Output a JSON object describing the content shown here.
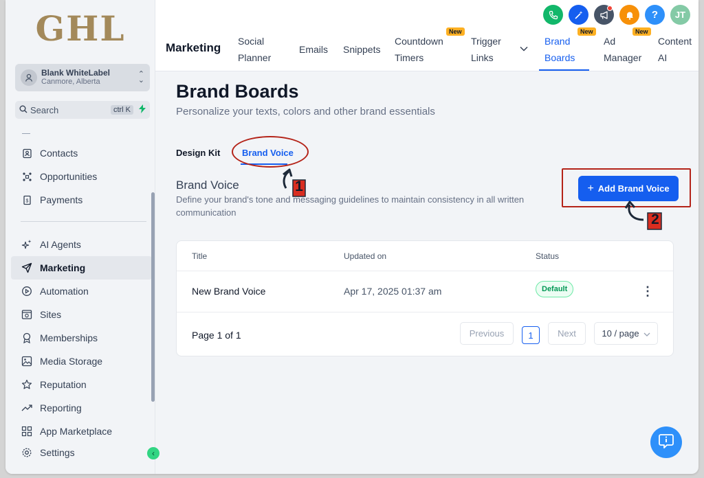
{
  "brand": {
    "logo_text": "GHL"
  },
  "account": {
    "name": "Blank WhiteLabel",
    "location": "Canmore, Alberta"
  },
  "search": {
    "label": "Search",
    "shortcut": "ctrl K"
  },
  "sidebar": {
    "items_top": [
      {
        "label": "Contacts",
        "icon": "contacts-icon"
      },
      {
        "label": "Opportunities",
        "icon": "opportunities-icon"
      },
      {
        "label": "Payments",
        "icon": "payments-icon"
      }
    ],
    "items_bottom": [
      {
        "label": "AI Agents",
        "icon": "sparkle-icon"
      },
      {
        "label": "Marketing",
        "icon": "send-icon",
        "active": true
      },
      {
        "label": "Automation",
        "icon": "automation-icon"
      },
      {
        "label": "Sites",
        "icon": "sites-icon"
      },
      {
        "label": "Memberships",
        "icon": "award-icon"
      },
      {
        "label": "Media Storage",
        "icon": "image-icon"
      },
      {
        "label": "Reputation",
        "icon": "star-icon"
      },
      {
        "label": "Reporting",
        "icon": "trend-icon"
      },
      {
        "label": "App Marketplace",
        "icon": "grid-icon"
      },
      {
        "label": "Settings",
        "icon": "gear-icon"
      }
    ]
  },
  "header": {
    "section": "Marketing",
    "tabs": [
      {
        "line1": "Social",
        "line2": "Planner"
      },
      {
        "line1": "Emails"
      },
      {
        "line1": "Snippets"
      },
      {
        "line1": "Countdown",
        "line2": "Timers",
        "badge": "New"
      },
      {
        "line1": "Trigger",
        "line2": "Links"
      },
      {
        "line1": "Brand",
        "line2": "Boards",
        "badge": "New",
        "active": true
      },
      {
        "line1": "Ad",
        "line2": "Manager",
        "badge": "New"
      },
      {
        "line1": "Content",
        "line2": "AI"
      }
    ],
    "user_initials": "JT",
    "icon_colors": {
      "phone": "#12b76a",
      "magic": "#155eef",
      "announce": "#475467",
      "bell": "#f79009",
      "help": "#2e90fa",
      "avatar": "#84caa6"
    }
  },
  "page": {
    "title": "Brand Boards",
    "subtitle": "Personalize your texts, colors and other brand essentials",
    "subtabs": [
      "Design Kit",
      "Brand Voice"
    ],
    "section_title": "Brand Voice",
    "section_desc": "Define your brand's tone and messaging guidelines to maintain consistency in all written communication",
    "add_button": "Add Brand Voice",
    "step1": "1",
    "step2": "2"
  },
  "table": {
    "columns": [
      "Title",
      "Updated on",
      "Status"
    ],
    "rows": [
      {
        "title": "New Brand Voice",
        "updated": "Apr 17, 2025 01:37 am",
        "status": "Default"
      }
    ],
    "pagination": {
      "info": "Page 1 of 1",
      "previous": "Previous",
      "current": "1",
      "next": "Next",
      "per_page": "10 / page"
    }
  }
}
